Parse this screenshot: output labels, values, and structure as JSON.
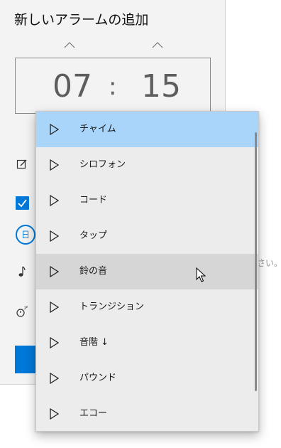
{
  "dialog": {
    "title": "新しいアラームの追加",
    "time": {
      "hour": "07",
      "separator": ":",
      "minute": "15"
    },
    "repeat_day_chip": "日",
    "partial_hint_text": "さい。"
  },
  "dropdown": {
    "items": [
      {
        "label": "チャイム",
        "state": "selected"
      },
      {
        "label": "シロフォン",
        "state": "normal"
      },
      {
        "label": "コード",
        "state": "normal"
      },
      {
        "label": "タップ",
        "state": "normal"
      },
      {
        "label": "鈴の音",
        "state": "hovered"
      },
      {
        "label": "トランジション",
        "state": "normal"
      },
      {
        "label": "音階 ↓",
        "state": "normal"
      },
      {
        "label": "パウンド",
        "state": "normal"
      },
      {
        "label": "エコー",
        "state": "normal"
      }
    ]
  },
  "colors": {
    "accent": "#0078d7",
    "selected_row": "#a9d5fb",
    "hovered_row": "#d6d6d6"
  },
  "icons": {
    "hour_up": "chevron-up-icon",
    "minute_up": "chevron-up-icon",
    "name": "edit-icon",
    "sound": "music-note-icon",
    "snooze": "snooze-icon",
    "play": "play-icon"
  }
}
